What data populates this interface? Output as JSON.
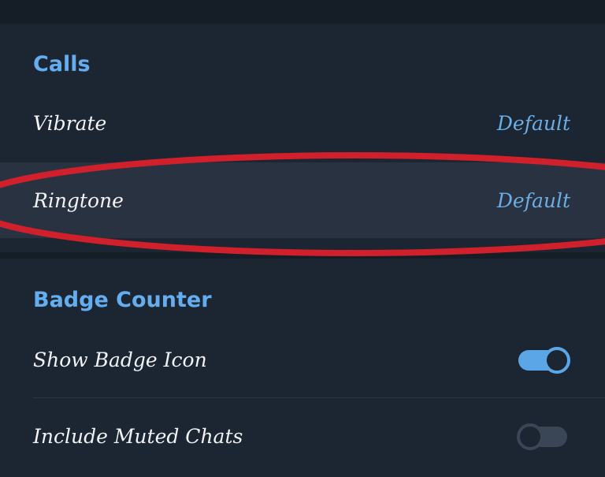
{
  "calls": {
    "title": "Calls",
    "vibrate": {
      "label": "Vibrate",
      "value": "Default"
    },
    "ringtone": {
      "label": "Ringtone",
      "value": "Default"
    }
  },
  "badge_counter": {
    "title": "Badge Counter",
    "show_badge_icon": {
      "label": "Show Badge Icon",
      "enabled": true
    },
    "include_muted_chats": {
      "label": "Include Muted Chats",
      "enabled": false
    }
  },
  "colors": {
    "accent": "#64aef0",
    "background": "#1c2532",
    "highlight_annotation": "#d0202c"
  }
}
